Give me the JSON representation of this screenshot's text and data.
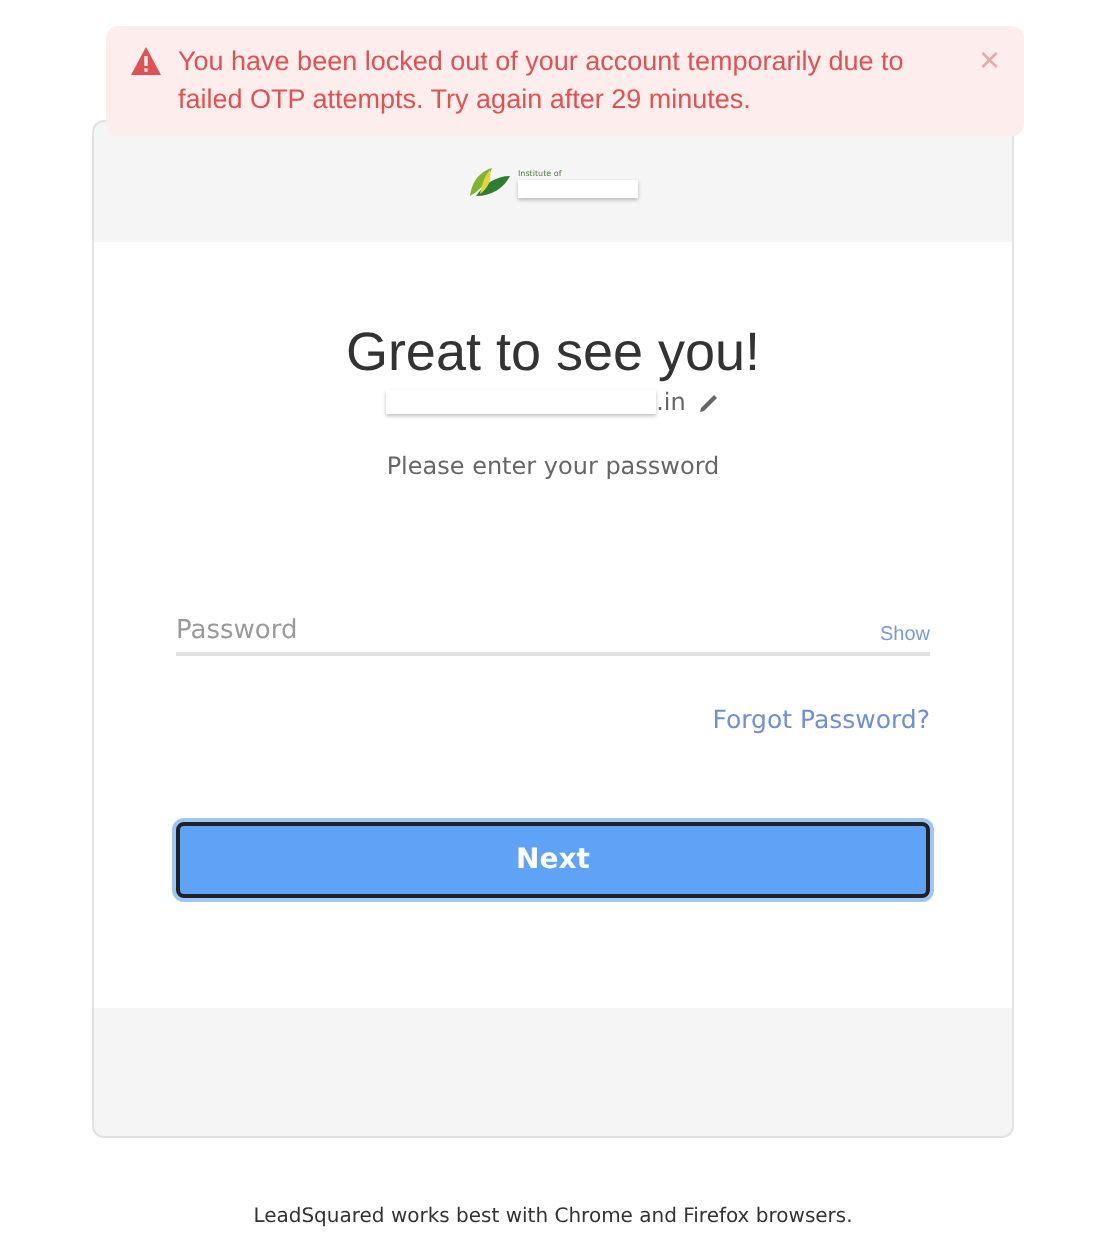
{
  "alert": {
    "kind": "error",
    "message": "You have been locked out of your account temporarily due to failed OTP attempts. Try again after 29 minutes.",
    "close": "×"
  },
  "logo": {
    "caption": "Institute of"
  },
  "login": {
    "title": "Great to see you!",
    "email": ".in",
    "prompt": "Please enter your password",
    "password": {
      "placeholder": "Password",
      "toggle": "Show"
    },
    "forgot": "Forgot Password?",
    "submit": "Next"
  },
  "footer": "LeadSquared works best with Chrome and Firefox browsers."
}
